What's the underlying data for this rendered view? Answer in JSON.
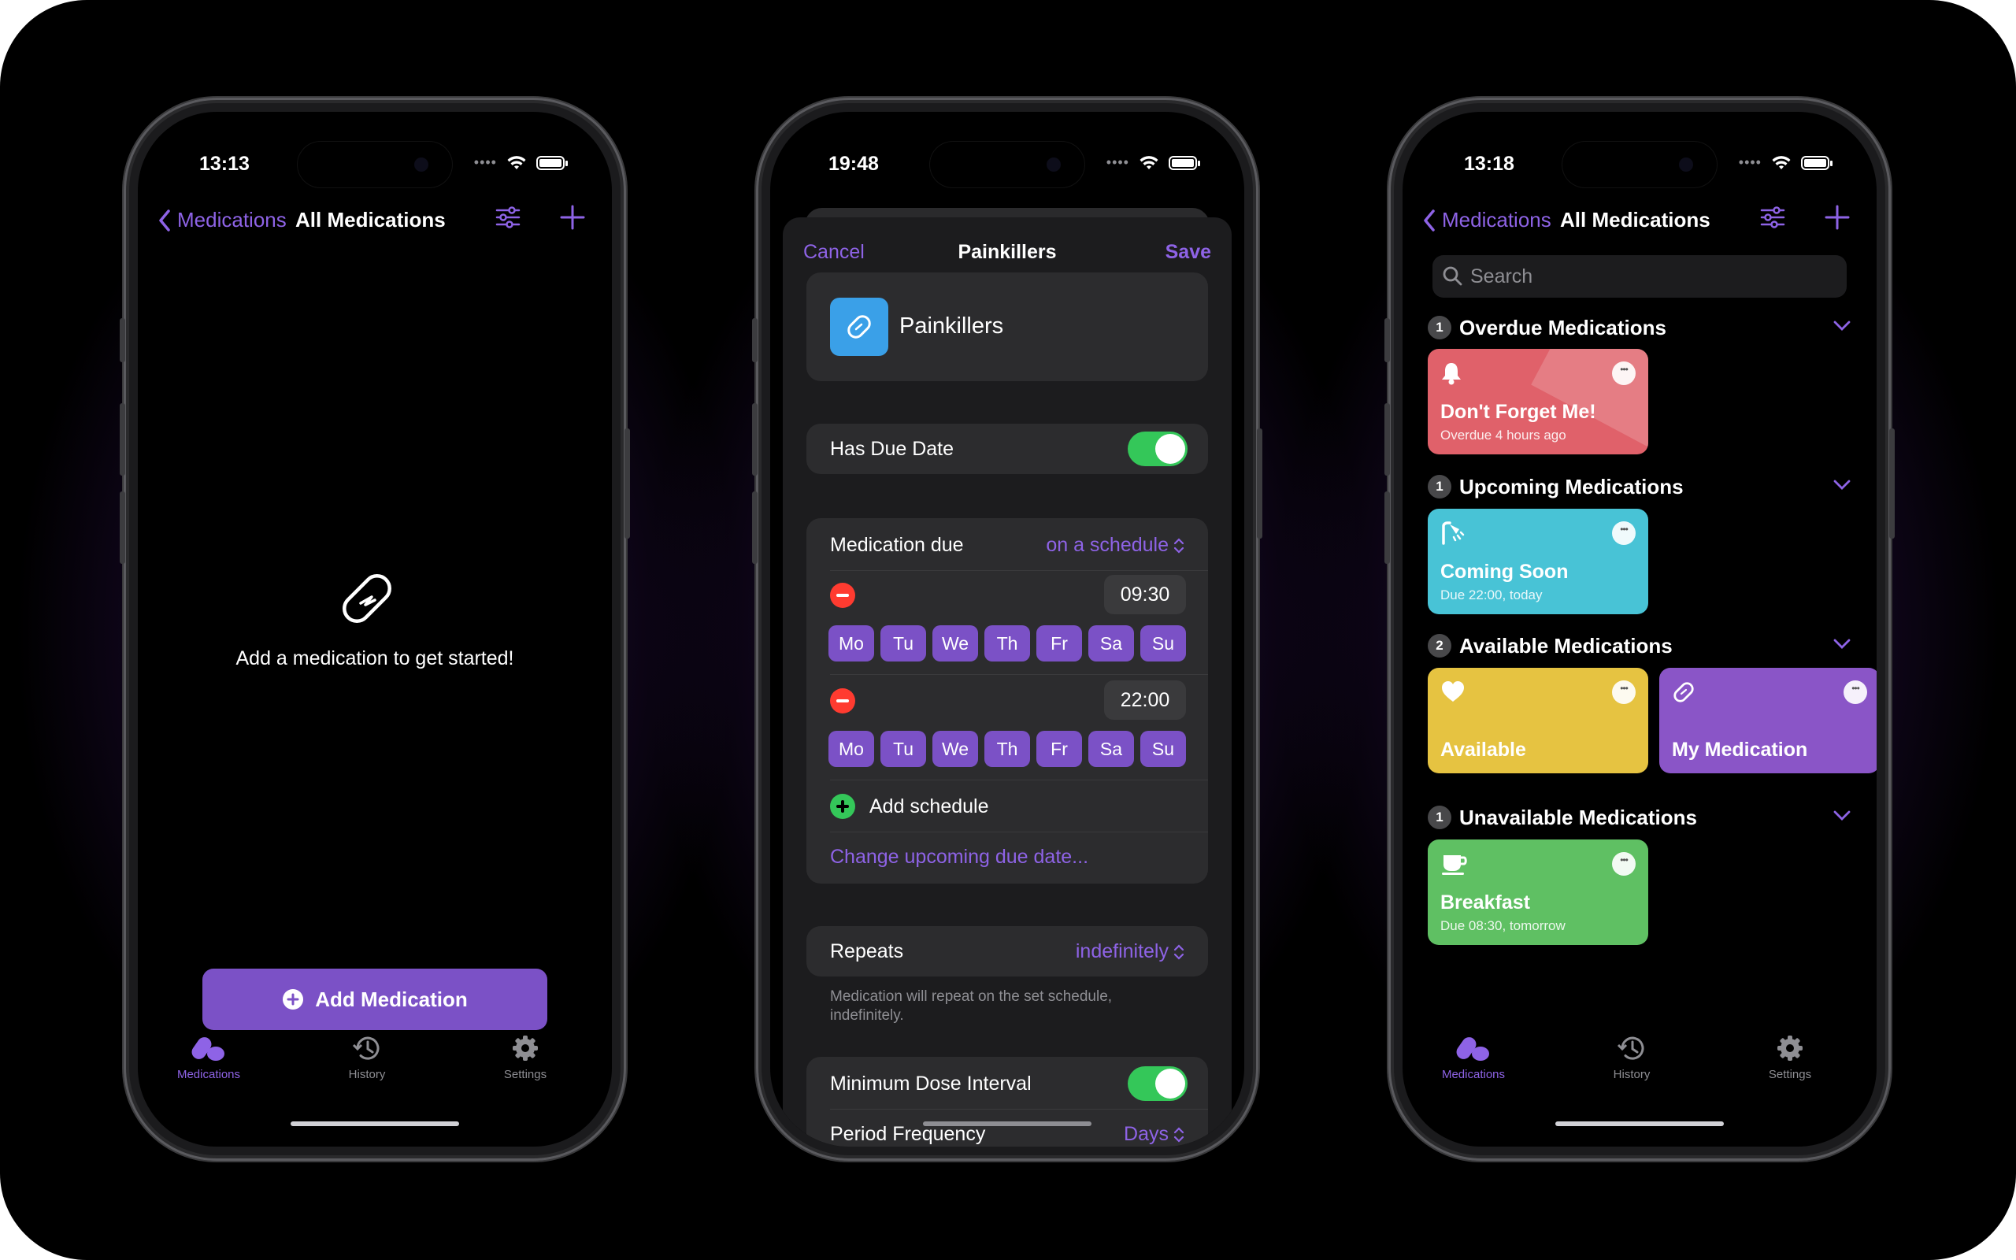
{
  "colors": {
    "accent": "#8b5cf6",
    "accent_button": "#7b51c6",
    "toggle_on": "#34c759",
    "overdue": "#e0616a",
    "upcoming": "#48c3d6",
    "available": "#e6c341",
    "my_medication": "#8a55c7",
    "unavailable": "#5fc063"
  },
  "phone1": {
    "time": "13:13",
    "nav": {
      "back_label": "Medications",
      "title": "All Medications",
      "filter_icon": "sliders-icon",
      "add_icon": "plus-icon"
    },
    "empty_state": {
      "icon": "pill-icon",
      "message": "Add a medication to get started!"
    },
    "add_button_label": "Add Medication",
    "tabs": [
      {
        "label": "Medications",
        "icon": "pills-icon",
        "active": true
      },
      {
        "label": "History",
        "icon": "history-icon",
        "active": false
      },
      {
        "label": "Settings",
        "icon": "gear-icon",
        "active": false
      }
    ]
  },
  "phone2": {
    "time": "19:48",
    "sheet": {
      "cancel_label": "Cancel",
      "title": "Painkillers",
      "save_label": "Save",
      "name_value": "Painkillers",
      "has_due_date_label": "Has Due Date",
      "has_due_date_on": true,
      "medication_due_label": "Medication due",
      "medication_due_value": "on a schedule",
      "schedules": [
        {
          "time": "09:30",
          "days": [
            "Mo",
            "Tu",
            "We",
            "Th",
            "Fr",
            "Sa",
            "Su"
          ]
        },
        {
          "time": "22:00",
          "days": [
            "Mo",
            "Tu",
            "We",
            "Th",
            "Fr",
            "Sa",
            "Su"
          ]
        }
      ],
      "add_schedule_label": "Add schedule",
      "change_due_label": "Change upcoming due date...",
      "repeats_label": "Repeats",
      "repeats_value": "indefinitely",
      "repeats_footnote": "Medication will repeat on the set schedule, indefinitely.",
      "min_dose_label": "Minimum Dose Interval",
      "min_dose_on": true,
      "period_label": "Period Frequency",
      "period_value": "Days"
    }
  },
  "phone3": {
    "time": "13:18",
    "nav": {
      "back_label": "Medications",
      "title": "All Medications"
    },
    "search_placeholder": "Search",
    "sections": [
      {
        "count": "1",
        "title": "Overdue Medications"
      },
      {
        "count": "1",
        "title": "Upcoming Medications"
      },
      {
        "count": "2",
        "title": "Available Medications"
      },
      {
        "count": "1",
        "title": "Unavailable Medications"
      }
    ],
    "cards": {
      "overdue": {
        "title": "Don't Forget Me!",
        "subtitle": "Overdue 4 hours ago",
        "icon": "bell-icon"
      },
      "upcoming": {
        "title": "Coming Soon",
        "subtitle": "Due 22:00, today",
        "icon": "shower-icon"
      },
      "available": {
        "title": "Available",
        "icon": "heart-icon"
      },
      "my_medication": {
        "title": "My Medication",
        "icon": "pill-icon"
      },
      "breakfast": {
        "title": "Breakfast",
        "subtitle": "Due 08:30, tomorrow",
        "icon": "cup-icon"
      }
    },
    "tabs": [
      {
        "label": "Medications"
      },
      {
        "label": "History"
      },
      {
        "label": "Settings"
      }
    ]
  }
}
